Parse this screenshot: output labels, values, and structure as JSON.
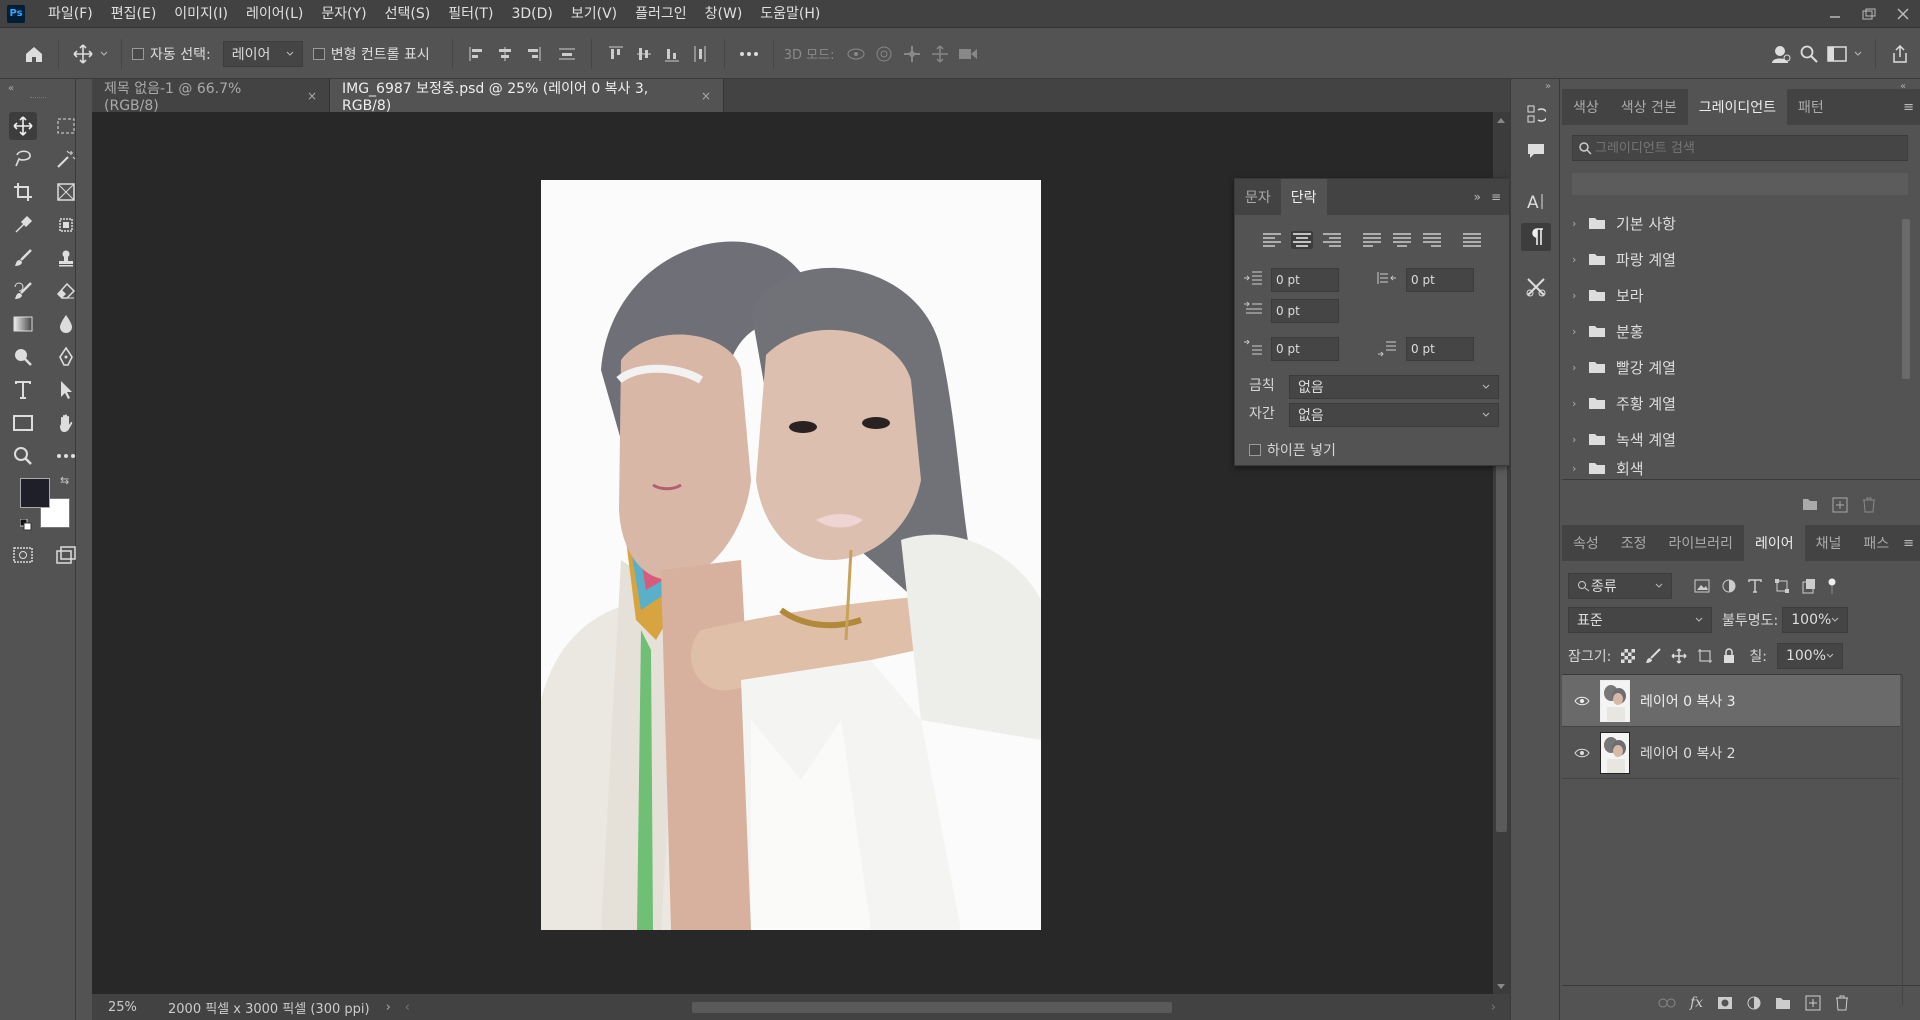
{
  "app": {
    "logo": "Ps"
  },
  "menu": [
    "파일(F)",
    "편집(E)",
    "이미지(I)",
    "레이어(L)",
    "문자(Y)",
    "선택(S)",
    "필터(T)",
    "3D(D)",
    "보기(V)",
    "플러그인",
    "창(W)",
    "도움말(H)"
  ],
  "options": {
    "auto_select_label": "자동 선택:",
    "auto_select_target": "레이어",
    "transform_controls_label": "변형 컨트롤 표시",
    "mode_3d_label": "3D 모드:"
  },
  "tabs": [
    {
      "label": "제목 없음-1 @ 66.7% (RGB/8)",
      "close": "×"
    },
    {
      "label": "IMG_6987 보정중.psd @ 25% (레이어 0 복사 3, RGB/8)",
      "close": "×"
    }
  ],
  "status": {
    "zoom": "25%",
    "doc_info": "2000 픽셀 x 3000 픽셀 (300 ppi)",
    "arrow": "›"
  },
  "paragraph_panel": {
    "tabs": [
      "문자",
      "단락"
    ],
    "indent_left": "0 pt",
    "indent_right": "0 pt",
    "indent_first": "0 pt",
    "space_before": "0 pt",
    "space_after": "0 pt",
    "kinsoku_label": "금칙",
    "kinsoku_value": "없음",
    "mojikumi_label": "자간",
    "mojikumi_value": "없음",
    "hyphenate_label": "하이픈 넣기"
  },
  "gradient_panel": {
    "tabs": [
      "색상",
      "색상 견본",
      "그레이디언트",
      "패턴"
    ],
    "search_placeholder": "그레이디언트 검색",
    "folders": [
      "기본 사항",
      "파랑 계열",
      "보라",
      "분홍",
      "빨강 계열",
      "주황 계열",
      "녹색 계열",
      "회색"
    ]
  },
  "layers_panel": {
    "tabs": [
      "속성",
      "조정",
      "라이브러리",
      "레이어",
      "채널",
      "패스"
    ],
    "filter_kind": "종류",
    "blend_mode": "표준",
    "opacity_label": "불투명도:",
    "opacity_value": "100%",
    "lock_label": "잠그기:",
    "fill_label": "칠:",
    "fill_value": "100%",
    "layers": [
      {
        "name": "레이어 0 복사 3",
        "active": true
      },
      {
        "name": "레이어 0 복사 2",
        "active": false
      }
    ],
    "fx_label": "fx"
  }
}
